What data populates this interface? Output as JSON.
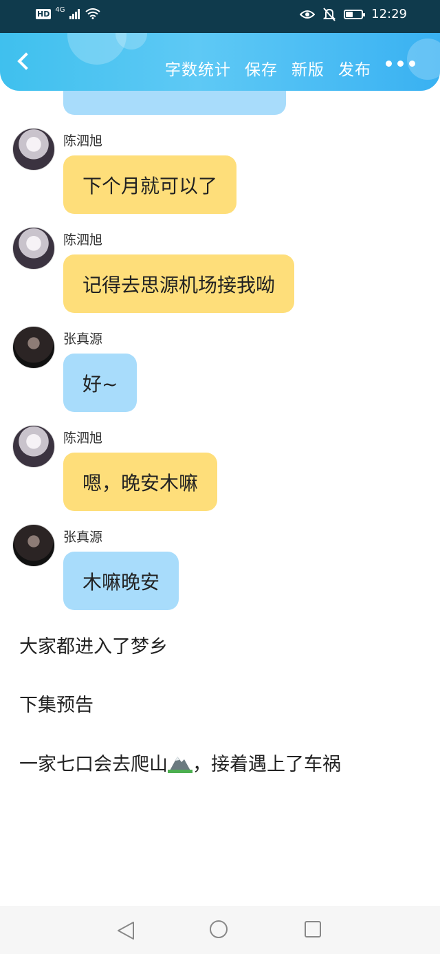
{
  "status_bar": {
    "hd": "HD",
    "network": "4G",
    "time": "12:29",
    "battery_level": 0.5
  },
  "header": {
    "actions": [
      "字数统计",
      "保存",
      "新版",
      "发布"
    ]
  },
  "messages": [
    {
      "sender": "陈泗旭",
      "text": "下个月就可以了",
      "color": "#fede7a",
      "avatar": "chen"
    },
    {
      "sender": "陈泗旭",
      "text": "记得去思源机场接我呦",
      "color": "#fede7a",
      "avatar": "chen"
    },
    {
      "sender": "张真源",
      "text": "好~",
      "color": "#a8dcfb",
      "avatar": "zhang"
    },
    {
      "sender": "陈泗旭",
      "text": "嗯，晚安木嘛",
      "color": "#fede7a",
      "avatar": "chen"
    },
    {
      "sender": "张真源",
      "text": "木嘛晚安",
      "color": "#a8dcfb",
      "avatar": "zhang"
    }
  ],
  "story": {
    "line1": "大家都进入了梦乡",
    "line2": "下集预告",
    "line3_before": "一家七口会去爬山",
    "line3_icon": "mountain-emoji",
    "line3_after": "，接着遇上了车祸"
  },
  "colors": {
    "header_start": "#3fc0ee",
    "header_end": "#39b1f2",
    "bubble_yellow": "#fede7a",
    "bubble_blue": "#a8dcfb"
  }
}
